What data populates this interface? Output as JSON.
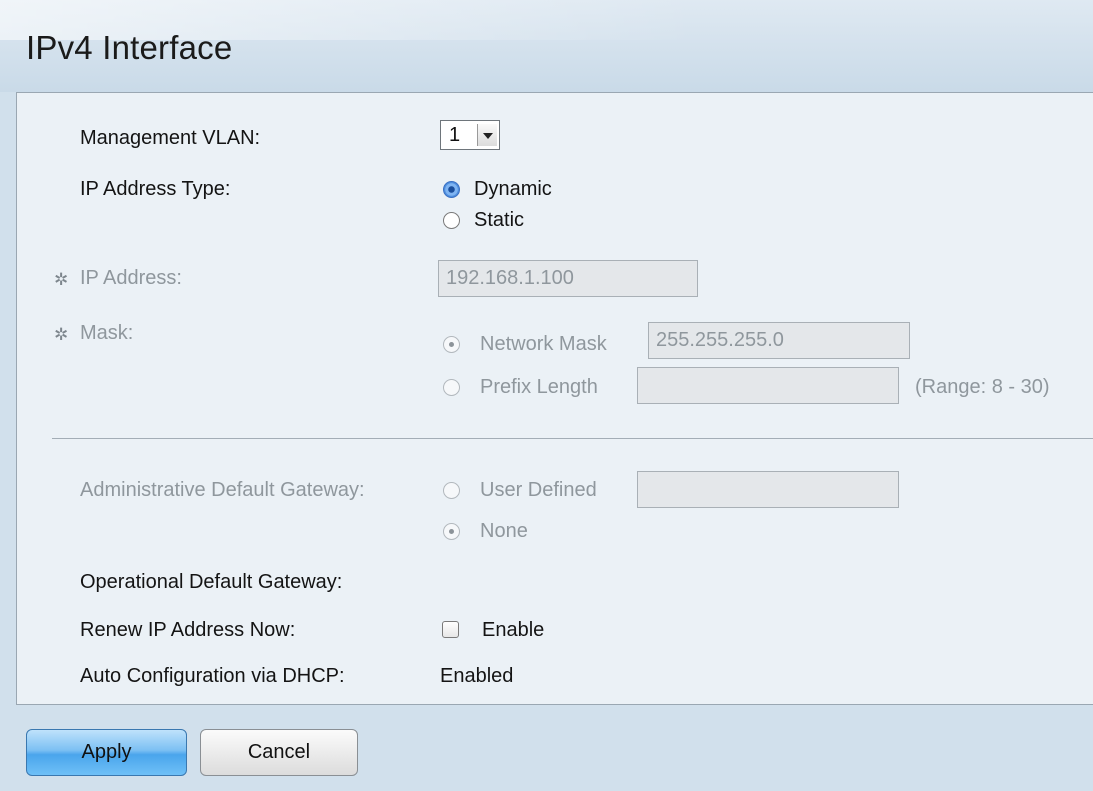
{
  "page": {
    "title": "IPv4 Interface"
  },
  "form": {
    "management_vlan": {
      "label": "Management VLAN:",
      "value": "1"
    },
    "ip_address_type": {
      "label": "IP Address Type:",
      "options": [
        "Dynamic",
        "Static"
      ],
      "selected": "Dynamic"
    },
    "ip_address": {
      "label": "IP Address:",
      "value": "192.168.1.100"
    },
    "mask": {
      "label": "Mask:",
      "network_mask_label": "Network Mask",
      "network_mask_value": "255.255.255.0",
      "prefix_length_label": "Prefix Length",
      "prefix_length_value": "",
      "range_text": "(Range: 8 - 30)",
      "selected": "Network Mask"
    },
    "admin_gateway": {
      "label": "Administrative Default Gateway:",
      "user_defined_label": "User Defined",
      "user_defined_value": "",
      "none_label": "None",
      "selected": "None"
    },
    "operational_gateway": {
      "label": "Operational Default Gateway:",
      "value": ""
    },
    "renew_ip": {
      "label": "Renew IP Address Now:",
      "checkbox_label": "Enable",
      "checked": false
    },
    "auto_config": {
      "label": "Auto Configuration via DHCP:",
      "value": "Enabled"
    }
  },
  "buttons": {
    "apply": "Apply",
    "cancel": "Cancel"
  },
  "colors": {
    "apply_button": "#4aa5ec",
    "radio_selected": "#3a70c4",
    "disabled_text": "#8f979d"
  },
  "icons": {
    "required_marker": "gear-icon"
  }
}
